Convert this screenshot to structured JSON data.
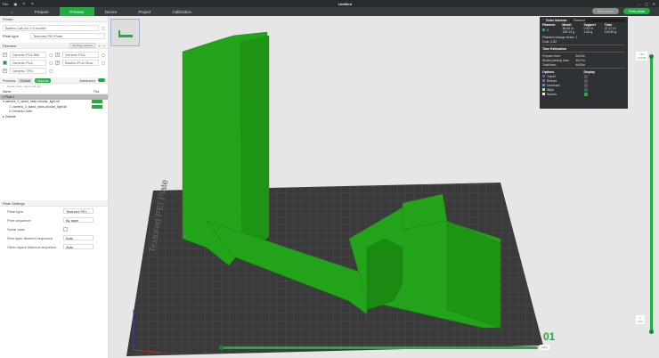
{
  "titlebar": {
    "file": "File",
    "title": "Untitled"
  },
  "nav": {
    "tabs": [
      "Prepare",
      "Preview",
      "Device",
      "Project",
      "Calibration"
    ],
    "slice_plate": "Slice plate",
    "print_plate": "Print plate"
  },
  "printer": {
    "header": "Printer",
    "name": "Bambu Lab A1 0.4 nozzle",
    "plate_type_label": "Plate type",
    "plate_type": "Textured PEI Plate"
  },
  "filament": {
    "header": "Filament",
    "flushing": "Flushing volumes",
    "items": [
      {
        "n": "1",
        "name": "Generic PLA Silk",
        "color": "#ffffff"
      },
      {
        "n": "2",
        "name": "Generic PLA",
        "color": "#ffffff"
      },
      {
        "n": "3",
        "name": "Generic PLA",
        "color": "#1fae3d"
      },
      {
        "n": "4",
        "name": "Bambu PLA Glow",
        "color": "#ffffff"
      },
      {
        "n": "5",
        "name": "Generic TPU",
        "color": "#ffffff"
      }
    ]
  },
  "process": {
    "header": "Process",
    "global": "Global",
    "objects": "Objects",
    "advanced": "Advanced",
    "search": "Search plate, object and part",
    "col_name": "Name",
    "col_fil": "Fila.",
    "tree": [
      "Plate 1",
      "camera_3_stand_main-circular_light.stl",
      "camera_3_stand_main-circular_light.stl",
      "Generic-Cube",
      "Outside"
    ]
  },
  "plate_settings": {
    "header": "Plate Settings",
    "rows": [
      {
        "label": "Plate type",
        "value": "Textured PEI..."
      },
      {
        "label": "Print sequence",
        "value": "By layer"
      },
      {
        "label": "Spiral vase",
        "value": ""
      },
      {
        "label": "First layer filament sequence",
        "value": "Auto"
      },
      {
        "label": "Other layers filament sequence",
        "value": "Auto"
      }
    ]
  },
  "legend": {
    "color_scheme": "Color Scheme",
    "scheme_value": "Filament",
    "cols": [
      "Filament",
      "Model",
      "Support",
      "Total"
    ],
    "row": {
      "id": "3",
      "model": "46.64 m\n139.13 g",
      "support": "0.52 m\n1.68 g",
      "total": "47.17 m\n140.80 g"
    },
    "change_times": "Filament change times: 1",
    "cost": "Cost: 2.82",
    "time_header": "Time Estimation",
    "prepare_label": "Prepare time:",
    "prepare": "4m23s",
    "model_time_label": "Model printing time:",
    "model_time": "4h27m",
    "total_label": "Total time:",
    "total": "4h32m",
    "options": "Options",
    "display": "Display",
    "opts": [
      {
        "name": "Travel",
        "color": "#5555dd"
      },
      {
        "name": "Retract",
        "color": "#cc33cc"
      },
      {
        "name": "Unretract",
        "color": "#33aacc"
      },
      {
        "name": "Wipe",
        "color": "#eedd22"
      },
      {
        "name": "Seams",
        "color": "#eeeeee"
      }
    ]
  },
  "slider": {
    "top_layer": "715",
    "top_height": "143.00",
    "bottom_layer": "1",
    "bottom_height": "0.24",
    "h_value": "1391"
  },
  "plate_label": "01",
  "bed_text": "Textured PEI Plate"
}
